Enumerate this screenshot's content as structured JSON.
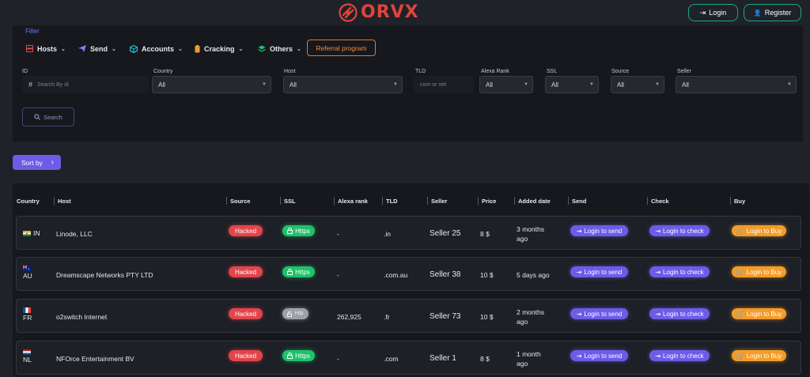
{
  "brand": {
    "name": "ORVX",
    "color": "#e0443a"
  },
  "auth": {
    "login": "Login",
    "register": "Register"
  },
  "filter": {
    "title": "Filter",
    "menu": [
      "Hosts",
      "Send",
      "Accounts",
      "Cracking",
      "Others"
    ],
    "referral": "Referral program",
    "fields": {
      "id": {
        "label": "ID",
        "placeholder": "Search By id",
        "prefix": "#"
      },
      "country": {
        "label": "Country",
        "value": "All"
      },
      "host": {
        "label": "Host",
        "value": "All"
      },
      "tld": {
        "label": "TLD",
        "placeholder": "com or net"
      },
      "alexa": {
        "label": "Alexa Rank",
        "value": "All"
      },
      "ssl": {
        "label": "SSL",
        "value": "All"
      },
      "source": {
        "label": "Source",
        "value": "All"
      },
      "seller": {
        "label": "Seller",
        "value": "All"
      }
    },
    "search": "Search"
  },
  "sort": {
    "label": "Sort by"
  },
  "table": {
    "headers": [
      "Country",
      "Host",
      "Source",
      "SSL",
      "Alexa rank",
      "TLD",
      "Seller",
      "Price",
      "Added date",
      "Send",
      "Check",
      "Buy"
    ],
    "rows": [
      {
        "country": "IN",
        "flag": "in",
        "host": "Linode, LLC",
        "source": "Hacked",
        "ssl": "Https",
        "alexa": "-",
        "tld": ".in",
        "seller": "Seller 25",
        "price": "8 $",
        "date1": "3 months",
        "date2": "ago",
        "send": "Login to send",
        "check": "Login to check",
        "buy": "Login to Buy"
      },
      {
        "country": "AU",
        "flag": "au",
        "host": "Dreamscape Networks PTY LTD",
        "source": "Hacked",
        "ssl": "Https",
        "alexa": "-",
        "tld": ".com.au",
        "seller": "Seller 38",
        "price": "10 $",
        "date1": "5 days ago",
        "date2": "",
        "send": "Login to send",
        "check": "Login to check",
        "buy": "Login to Buy"
      },
      {
        "country": "FR",
        "flag": "fr",
        "host": "o2switch Internet",
        "source": "Hacked",
        "ssl": "Http",
        "alexa": "262,925",
        "tld": ".fr",
        "seller": "Seller 73",
        "price": "10 $",
        "date1": "2 months",
        "date2": "ago",
        "send": "Login to send",
        "check": "Login to check",
        "buy": "Login to Buy"
      },
      {
        "country": "NL",
        "flag": "nl",
        "host": "NFOrce Entertainment BV",
        "source": "Hacked",
        "ssl": "Https",
        "alexa": "-",
        "tld": ".com",
        "seller": "Seller 1",
        "price": "8 $",
        "date1": "1 month",
        "date2": "ago",
        "send": "Login to send",
        "check": "Login to check",
        "buy": "Login to Buy"
      }
    ]
  }
}
